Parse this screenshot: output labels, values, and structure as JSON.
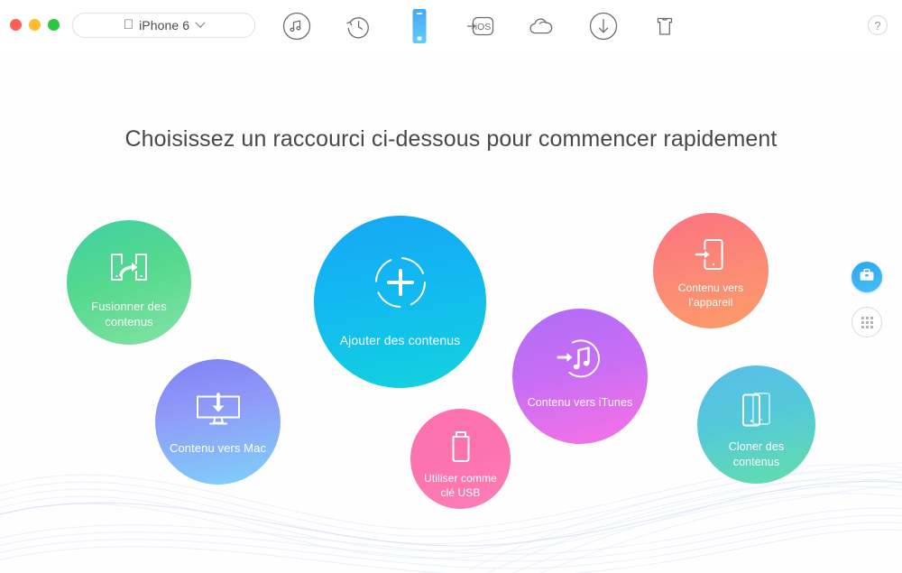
{
  "window": {
    "traffic_lights": [
      {
        "name": "close",
        "color": "#ff5f57"
      },
      {
        "name": "minimize",
        "color": "#febc2e"
      },
      {
        "name": "zoom",
        "color": "#28c840"
      }
    ],
    "device_selector": {
      "icon": "apple-logo-icon",
      "label": "iPhone 6",
      "chevron": "chevron-down-icon"
    },
    "help_label": "?"
  },
  "toolbar": {
    "items": [
      {
        "id": "music",
        "icon": "music-notes-circle-icon",
        "active": false
      },
      {
        "id": "history",
        "icon": "clock-rotate-back-icon",
        "active": false
      },
      {
        "id": "device",
        "icon": "iphone-device-icon",
        "active": true
      },
      {
        "id": "toios",
        "icon": "to-ios-box-icon",
        "active": false
      },
      {
        "id": "cloud",
        "icon": "cloud-icon",
        "active": false
      },
      {
        "id": "download",
        "icon": "download-arrow-circle-icon",
        "active": false
      },
      {
        "id": "toolkit",
        "icon": "tshirt-toolkit-icon",
        "active": false
      }
    ]
  },
  "main": {
    "headline": "Choisissez un raccourci ci-dessous pour commencer rapidement",
    "shortcuts": [
      {
        "id": "merge",
        "label": "Fusionner des contenus",
        "icon": "two-phones-arrow-icon",
        "colors": [
          "#3fd0a2",
          "#86e3a6"
        ]
      },
      {
        "id": "add",
        "label": "Ajouter des contenus",
        "icon": "plus-dashed-circle-icon",
        "colors": [
          "#17a7f4",
          "#14d3dd"
        ]
      },
      {
        "id": "todevice",
        "label": "Contenu vers l’appareil",
        "icon": "phone-arrow-in-icon",
        "colors": [
          "#fc7181",
          "#fb9d67"
        ]
      },
      {
        "id": "tomac",
        "label": "Contenu vers Mac",
        "icon": "monitor-download-icon",
        "colors": [
          "#8080f6",
          "#7fd1fb"
        ]
      },
      {
        "id": "usb",
        "label": "Utiliser comme clé USB",
        "icon": "usb-stick-icon",
        "colors": [
          "#fd71b0",
          "#fb7fb6"
        ]
      },
      {
        "id": "toitunes",
        "label": "Contenu vers iTunes",
        "icon": "music-note-arrow-icon",
        "colors": [
          "#b06cf6",
          "#f972e4"
        ]
      },
      {
        "id": "clone",
        "label": "Cloner des contenus",
        "icon": "two-phones-stacked-icon",
        "colors": [
          "#5bbdea",
          "#63dfa8"
        ]
      }
    ]
  },
  "side_tools": [
    {
      "id": "toolbox",
      "icon": "toolbox-icon",
      "active": true
    },
    {
      "id": "apps",
      "icon": "grid-apps-icon",
      "active": false
    }
  ]
}
